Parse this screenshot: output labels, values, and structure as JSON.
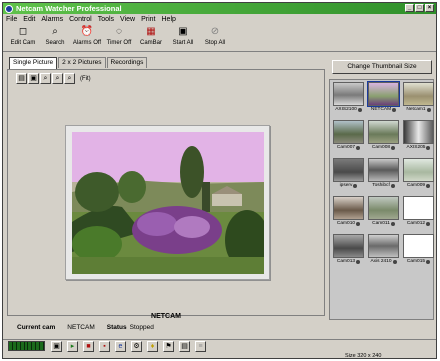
{
  "window": {
    "title": "Netcam Watcher Professional"
  },
  "menu": [
    "File",
    "Edit",
    "Alarms",
    "Control",
    "Tools",
    "View",
    "Print",
    "Help"
  ],
  "toolbar": [
    {
      "label": "Edit Cam",
      "icon": "edit-icon",
      "glyph": "◻"
    },
    {
      "label": "Search",
      "icon": "search-icon",
      "glyph": "⌕"
    },
    {
      "label": "Alarms Off",
      "icon": "alarm-icon",
      "glyph": "⏰"
    },
    {
      "label": "Timer Off",
      "icon": "timer-icon",
      "glyph": "◌"
    },
    {
      "label": "CamBar",
      "icon": "cambar-icon",
      "glyph": "▦"
    },
    {
      "label": "Start All",
      "icon": "camera-icon",
      "glyph": "▣"
    },
    {
      "label": "Stop All",
      "icon": "stop-icon",
      "glyph": "⊘"
    }
  ],
  "tabs": [
    "Single Picture",
    "2 x 2 Pictures",
    "Recordings"
  ],
  "zoom": {
    "fit_label": "(Fit)"
  },
  "camera": {
    "name": "NETCAM",
    "current_label": "Current cam",
    "current_value": "NETCAM",
    "status_label": "Status",
    "status_value": "Stopped"
  },
  "right": {
    "change_thumb_label": "Change Thumbnail Size",
    "thumbnails": [
      "AXIS2100",
      "NETCAM",
      "Netcam1",
      "Cam007",
      "Cam008",
      "AXIS205",
      "ipserv",
      "Toshibcf",
      "Cam009",
      "Cam010",
      "Cam011",
      "Cam012",
      "Cam013",
      "Axis 2410",
      "Cam015"
    ]
  },
  "status": {
    "size": "Size 320 x 240"
  },
  "colors": {
    "title_green": "#3aa832",
    "panel": "#d4d0c8"
  }
}
